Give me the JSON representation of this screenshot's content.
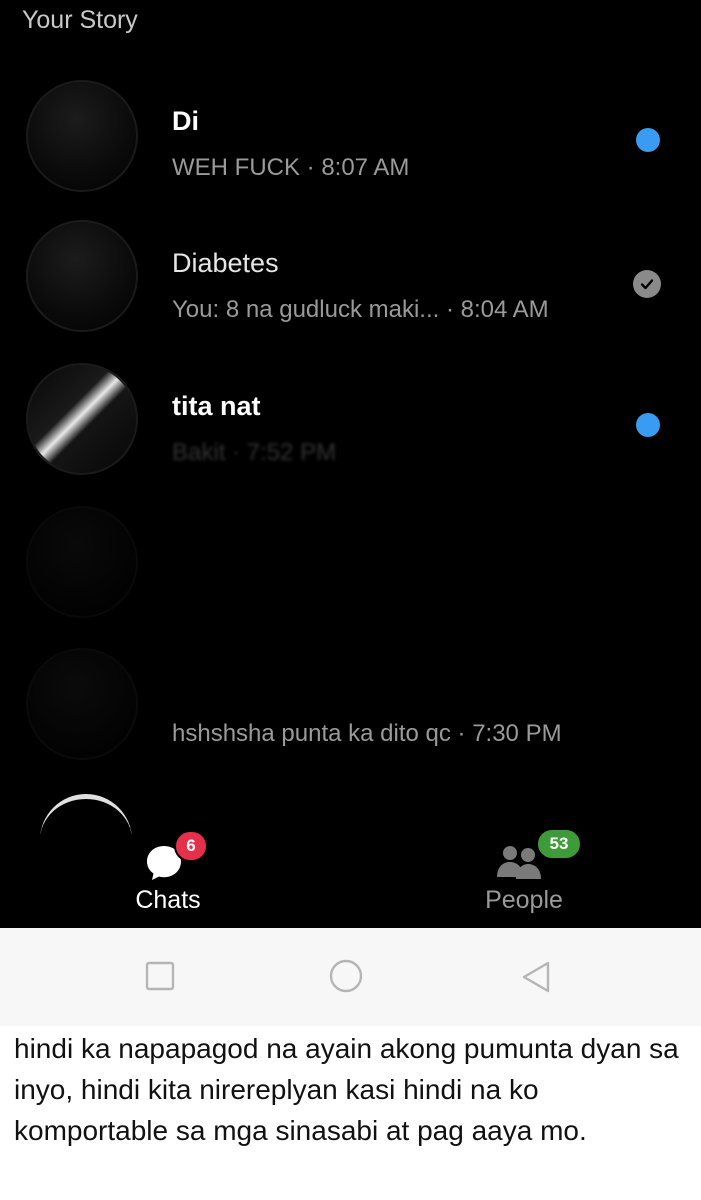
{
  "stories": {
    "your_story": "Your Story",
    "others": [
      "",
      "",
      ""
    ]
  },
  "chats": [
    {
      "name": "Di",
      "preview": "WEH FUCK · 8:07 AM",
      "status": "unread"
    },
    {
      "name": "Diabetes",
      "preview": "You: 8 na gudluck maki... · 8:04 AM",
      "status": "seen"
    },
    {
      "name": "tita nat",
      "preview": "Bakit · 7:52 PM",
      "status": "unread"
    },
    {
      "name": "",
      "preview": "",
      "status": "none"
    },
    {
      "name": "",
      "preview": "hshshsha punta ka dito qc · 7:30 PM",
      "status": "none"
    }
  ],
  "tabbar": {
    "chats_label": "Chats",
    "chats_badge": "6",
    "people_label": "People",
    "people_badge": "53"
  },
  "caption": "hindi ka napapagod na ayain akong pumunta dyan sa inyo, hindi kita nirereplyan kasi hindi na ko komportable sa mga sinasabi at pag aaya mo.",
  "colors": {
    "background": "#000000",
    "unread_dot": "#3a9bf2",
    "chats_badge": "#e4304a",
    "people_badge": "#3f9b3a"
  }
}
